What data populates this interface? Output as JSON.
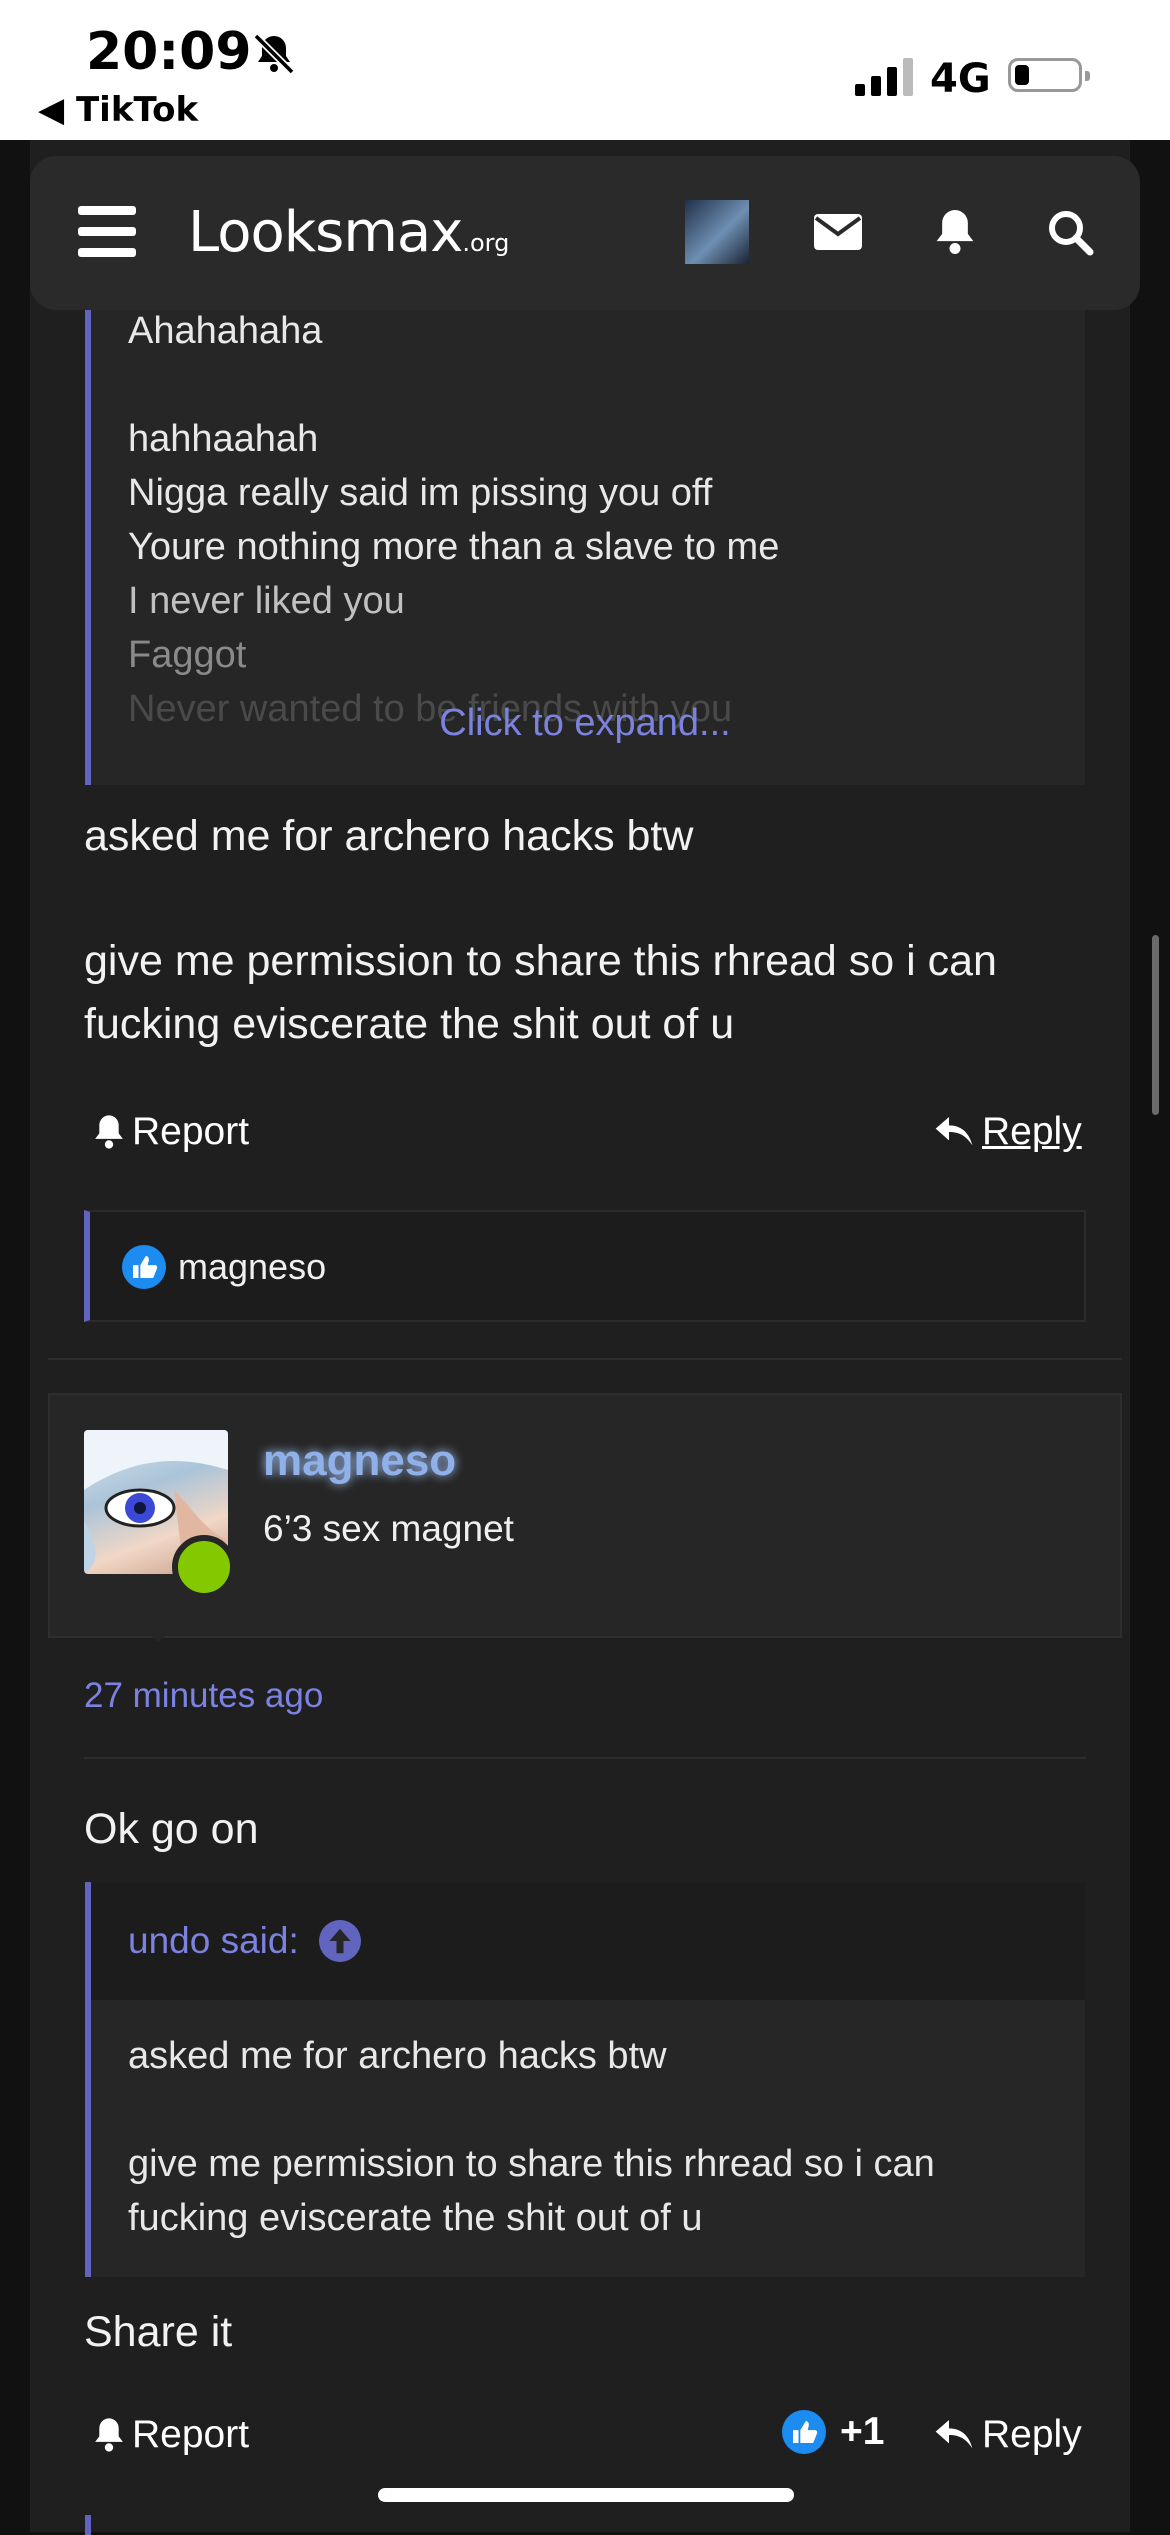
{
  "status_bar": {
    "time": "20:09",
    "back_app": "TikTok",
    "network": "4G"
  },
  "nav": {
    "logo": "Looksmax",
    "logo_suffix": ".org"
  },
  "post1": {
    "quote_lines": [
      "Ahahahaha",
      "hahhaahah",
      "Nigga really said im pissing you off",
      "Youre nothing more than a slave to me",
      "I never liked you",
      "Faggot",
      "Never wanted to be friends with you"
    ],
    "expand_label": "Click to expand...",
    "body_line1": "asked me for archero hacks btw",
    "body_line2": "give me permission to share this rhread so i can",
    "body_line3": "fucking eviscerate the shit out of u",
    "report_label": "Report",
    "reply_label": "Reply",
    "reaction_user": "magneso"
  },
  "post2": {
    "username": "magneso",
    "user_title": "6’3 sex magnet",
    "timestamp": "27 minutes ago",
    "body_intro": "Ok go on",
    "quote_attribution": "undo said:",
    "quote_line1": "asked me for archero hacks btw",
    "quote_line2": "give me permission to share this rhread so i can",
    "quote_line3": "fucking eviscerate the shit out of u",
    "body_outro": "Share it",
    "report_label": "Report",
    "reaction_count": "+1",
    "reply_label": "Reply"
  },
  "colors": {
    "accent": "#6165c0",
    "link": "#7c82e0",
    "online": "#84c800",
    "like": "#1d8cf0"
  }
}
